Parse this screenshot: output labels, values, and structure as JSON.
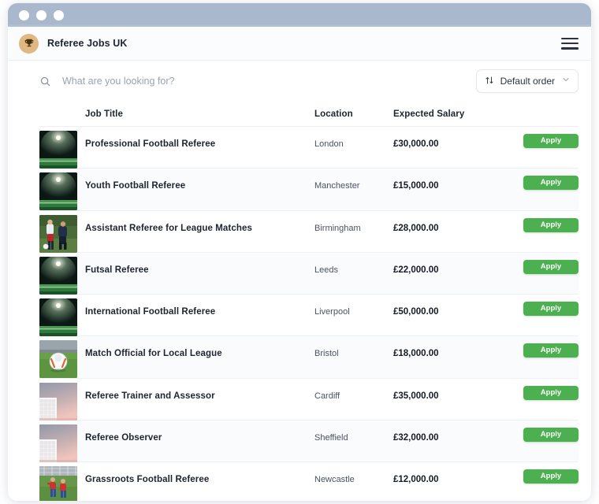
{
  "window": {
    "dots": [
      "close",
      "minimize",
      "maximize"
    ]
  },
  "header": {
    "brand_name": "Referee Jobs UK",
    "logo_icon": "trophy-icon",
    "menu_icon": "hamburger-menu-icon"
  },
  "toolbar": {
    "search_placeholder": "What are you looking for?",
    "search_value": "",
    "search_icon": "search-icon",
    "sort_label": "Default order",
    "sort_icon": "sort-arrows-icon",
    "chevron_icon": "chevron-down-icon"
  },
  "table": {
    "columns": {
      "thumbnail": "",
      "title": "Job Title",
      "location": "Location",
      "salary": "Expected Salary",
      "action": ""
    },
    "apply_label": "Apply",
    "accent_color": "#4caf50",
    "rows": [
      {
        "thumb": "stadium-floodlight-night",
        "title": "Professional Football Referee",
        "location": "London",
        "salary": "£30,000.00",
        "apply": "Apply"
      },
      {
        "thumb": "stadium-floodlight-night",
        "title": "Youth Football Referee",
        "location": "Manchester",
        "salary": "£15,000.00",
        "apply": "Apply"
      },
      {
        "thumb": "players-tackling",
        "title": "Assistant Referee for League Matches",
        "location": "Birmingham",
        "salary": "£28,000.00",
        "apply": "Apply"
      },
      {
        "thumb": "stadium-floodlight-night",
        "title": "Futsal Referee",
        "location": "Leeds",
        "salary": "£22,000.00",
        "apply": "Apply"
      },
      {
        "thumb": "stadium-floodlight-night",
        "title": "International Football Referee",
        "location": "Liverpool",
        "salary": "£50,000.00",
        "apply": "Apply"
      },
      {
        "thumb": "football-on-grass",
        "title": "Match Official for Local League",
        "location": "Bristol",
        "salary": "£18,000.00",
        "apply": "Apply"
      },
      {
        "thumb": "goal-net-sunset",
        "title": "Referee Trainer and Assessor",
        "location": "Cardiff",
        "salary": "£35,000.00",
        "apply": "Apply"
      },
      {
        "thumb": "goal-net-sunset",
        "title": "Referee Observer",
        "location": "Sheffield",
        "salary": "£32,000.00",
        "apply": "Apply"
      },
      {
        "thumb": "youth-players-pitch",
        "title": "Grassroots Football Referee",
        "location": "Newcastle",
        "salary": "£12,000.00",
        "apply": "Apply"
      }
    ]
  }
}
